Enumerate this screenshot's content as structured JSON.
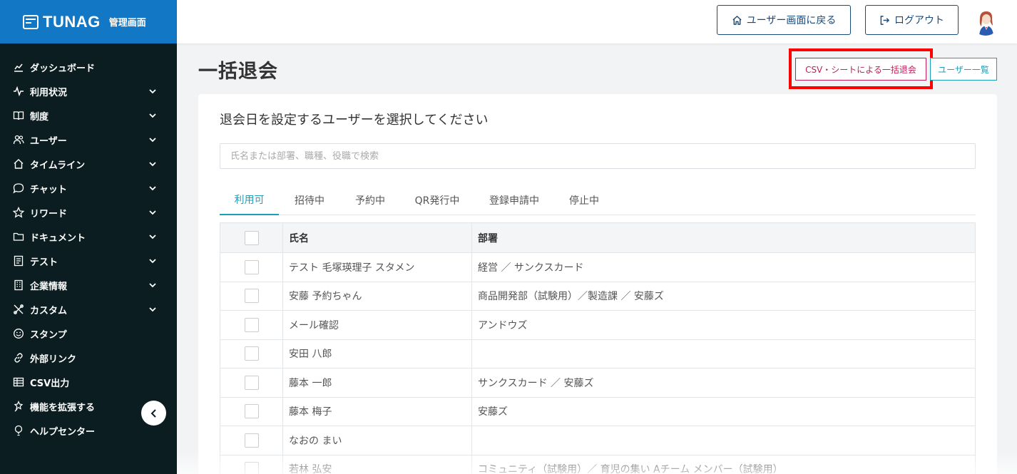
{
  "brand": {
    "name": "TUNAG",
    "sub": "管理画面"
  },
  "sidebar": {
    "items": [
      {
        "label": "ダッシュボード",
        "icon": "chart-icon",
        "chevron": false
      },
      {
        "label": "利用状況",
        "icon": "activity-icon",
        "chevron": true
      },
      {
        "label": "制度",
        "icon": "book-icon",
        "chevron": true
      },
      {
        "label": "ユーザー",
        "icon": "users-icon",
        "chevron": true
      },
      {
        "label": "タイムライン",
        "icon": "home-icon",
        "chevron": true
      },
      {
        "label": "チャット",
        "icon": "chat-icon",
        "chevron": true
      },
      {
        "label": "リワード",
        "icon": "star-icon",
        "chevron": true
      },
      {
        "label": "ドキュメント",
        "icon": "folder-icon",
        "chevron": true
      },
      {
        "label": "テスト",
        "icon": "test-icon",
        "chevron": true
      },
      {
        "label": "企業情報",
        "icon": "building-icon",
        "chevron": true
      },
      {
        "label": "カスタム",
        "icon": "tools-icon",
        "chevron": true
      },
      {
        "label": "スタンプ",
        "icon": "smile-icon",
        "chevron": false
      },
      {
        "label": "外部リンク",
        "icon": "link-icon",
        "chevron": false
      },
      {
        "label": "CSV出力",
        "icon": "table-icon",
        "chevron": false
      },
      {
        "label": "機能を拡張する",
        "icon": "extend-icon",
        "chevron": false
      },
      {
        "label": "ヘルプセンター",
        "icon": "help-icon",
        "chevron": false
      }
    ]
  },
  "header": {
    "back_label": "ユーザー画面に戻る",
    "logout_label": "ログアウト"
  },
  "page": {
    "title": "一括退会",
    "csv_button": "CSV・シートによる一括退会",
    "user_list_button": "ユーザー一覧"
  },
  "card": {
    "title": "退会日を設定するユーザーを選択してください",
    "search_placeholder": "氏名または部署、職種、役職で検索",
    "tabs": [
      "利用可",
      "招待中",
      "予約中",
      "QR発行中",
      "登録申請中",
      "停止中"
    ],
    "active_tab": 0
  },
  "table": {
    "headers": [
      "氏名",
      "部署"
    ],
    "rows": [
      {
        "name": "テスト 毛塚瑛理子 スタメン",
        "dept": "経営 ／ サンクスカード"
      },
      {
        "name": "安藤 予約ちゃん",
        "dept": "商品開発部（試験用）／製造課 ／ 安藤ズ"
      },
      {
        "name": "メール確認",
        "dept": "アンドウズ"
      },
      {
        "name": "安田 八郎",
        "dept": ""
      },
      {
        "name": "藤本 一郎",
        "dept": "サンクスカード ／ 安藤ズ"
      },
      {
        "name": "藤本 梅子",
        "dept": "安藤ズ"
      },
      {
        "name": "なおの まい",
        "dept": ""
      },
      {
        "name": "若林 弘安",
        "dept": "コミュニティ（試験用）／ 育児の集い Aチーム メンバー（試験用）"
      }
    ]
  },
  "colors": {
    "sidebar_bg": "#0b1d20",
    "brand_bg": "#1277c4",
    "accent_teal": "#1ba0b8",
    "danger_pink": "#c1205a",
    "highlight_red": "#ff0000",
    "header_button_navy": "#1a4a7a"
  }
}
